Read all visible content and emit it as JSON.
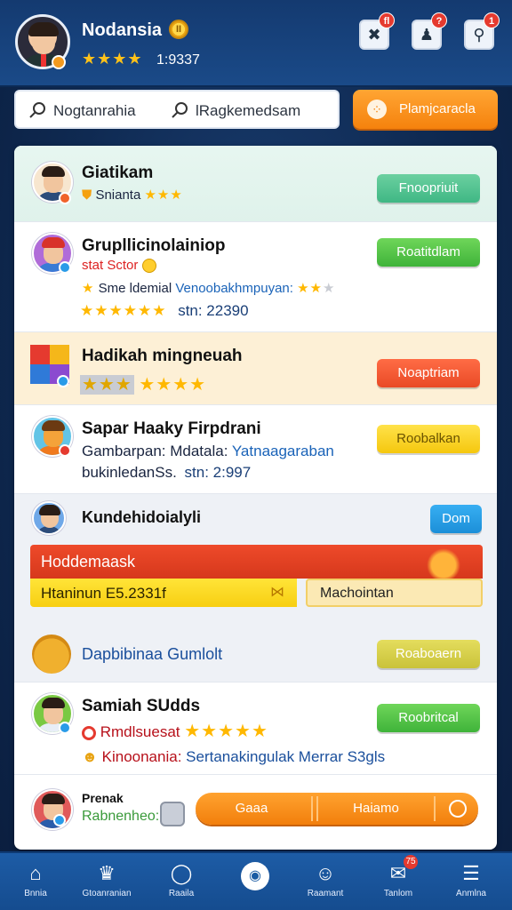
{
  "header": {
    "user_name": "Nodansia",
    "coin_symbol": "II",
    "stars": "★★★★",
    "score": "1:9337",
    "buttons": [
      {
        "icon": "tools-icon",
        "badge": "fl"
      },
      {
        "icon": "user-icon",
        "badge": "?"
      },
      {
        "icon": "search-person-icon",
        "badge": "1"
      }
    ]
  },
  "search": {
    "field1_text": "Nogtanrahia",
    "field2_text": "lRagkemedsam"
  },
  "play_button": {
    "label": "Plamjcaracla"
  },
  "rows": [
    {
      "title": "Giatikam",
      "subtitle": "Snianta",
      "stars": "★★★",
      "button": "Fnoopriuit"
    },
    {
      "title": "Grupllicinolainiop",
      "line2": "stat Sctor",
      "line3_prefix": "Sme ldemial",
      "line3_link": "Venoobakhmpuyan:",
      "line3_stars_on": "★★",
      "line3_stars_off": "★",
      "stars_row": "★★★★★★",
      "stat": "stn: 22390",
      "button": "Roatitdlam"
    },
    {
      "title": "Hadikah mingneuah",
      "stars_off": "★★★",
      "stars_on": "★★★★",
      "button": "Noaptriam"
    },
    {
      "title": "Sapar Haaky Firpdrani",
      "line2_a": "Gambarpan:",
      "line2_b": "Mdatala:",
      "line2_link": "Yatnaagaraban",
      "line3_a": "bukinledanSs.",
      "line3_b": "stn: 2:997",
      "button": "Roobalkan"
    },
    {
      "title": "Kundehidoialyli",
      "button": "Dom",
      "expand_header": "Hoddemaask",
      "expand_value": "Htaninun E5.2331f",
      "expand_option": "Machointan"
    },
    {
      "title": "Dapbibinaa Gumlolt",
      "button": "Roaboaern"
    },
    {
      "title": "Samiah SUdds",
      "tag": "Rmdlsuesat",
      "stars": "★★★★★",
      "line3_a": "Kinoonania:",
      "line3_b": "Sertanakingulak Merrar S3gls",
      "button": "Roobritcal"
    },
    {
      "title": "Prenak",
      "subtitle": "Rabnenheo:",
      "action_left": "Gaaa",
      "action_right": "Haiamo"
    }
  ],
  "bottom_nav": [
    {
      "icon": "home-icon",
      "label": "Bnnia"
    },
    {
      "icon": "crown-icon",
      "label": "Gtoanranian"
    },
    {
      "icon": "circle-icon",
      "label": "Raaila"
    },
    {
      "icon": "play-circle-icon",
      "label": ""
    },
    {
      "icon": "profile-icon",
      "label": "Raamant"
    },
    {
      "icon": "mail-icon",
      "label": "Tanlom",
      "badge": "75"
    },
    {
      "icon": "menu-icon",
      "label": "Anmlna"
    }
  ],
  "colors": {
    "header_bg": "#1a4a88",
    "accent_orange": "#f5820d",
    "green": "#3fb33a",
    "red": "#e94a26",
    "yellow": "#f5c70e",
    "blue": "#1c8fd8",
    "star": "#ffb800"
  }
}
